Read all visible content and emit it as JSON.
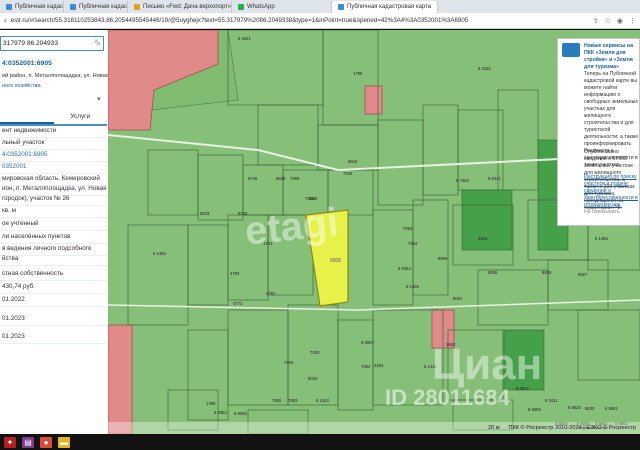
{
  "browser": {
    "tabs": [
      {
        "label": "Публичная кадастровая карта",
        "color": "#3a8fd0"
      },
      {
        "label": "Публичная кадастровая карта",
        "color": "#3a8fd0"
      },
      {
        "label": "Письмо «Fwd: Дача верхопорт»",
        "color": "#e0a21c"
      },
      {
        "label": "WhatsApp",
        "color": "#22b14c"
      },
      {
        "label": "Публичная кадастровая карта",
        "color": "#3a8fd0"
      }
    ],
    "url": "estr.ru/#/search/55.318110253843,86.2054495545446/19/@5uyghejx?text=55.317979%2086.2049338&type=1&inPoint=true&opened=42%3A4%3A0352001%3A6905"
  },
  "panel": {
    "search_value": "317979 86.204933",
    "breadcrumb_line1": "ий район, п. Металлплощадка, ул. Новая",
    "breadcrumb_line2": "ного хозяйства",
    "tab_left": "",
    "tab_right": "Услуги",
    "rows": [
      {
        "text": "ент недвижимости",
        "color": "#333"
      },
      {
        "text": "льный участок",
        "color": "#333"
      },
      {
        "text": "4:0352001:6905",
        "color": "#2a6fba"
      },
      {
        "text": "0352001",
        "color": "#2a6fba"
      },
      {
        "text": "мировская область, Кемеровский",
        "color": "#333"
      },
      {
        "text": "ион, п. Металлплощадка, ул. Новая",
        "color": "#333"
      },
      {
        "text": "городок), участок № 26",
        "color": "#333"
      },
      {
        "text": "кв. м",
        "color": "#333"
      },
      {
        "text": "ое учтенный",
        "color": "#333"
      },
      {
        "text": "ли населённых пунктов",
        "color": "#333"
      },
      {
        "text": "я ведения личного подсобного",
        "color": "#333"
      },
      {
        "text": "йства",
        "color": "#333"
      },
      {
        "text": "стная собственность",
        "color": "#333"
      },
      {
        "text": "430,74 руб.",
        "color": "#333"
      },
      {
        "text": "01.2022",
        "color": "#333"
      },
      {
        "text": "01.2023",
        "color": "#333"
      },
      {
        "text": "01.2023",
        "color": "#333"
      }
    ],
    "header_code": "4:0352001:6905"
  },
  "map": {
    "parcel_labels": [
      "6 2541",
      "1795",
      "6 3432",
      "7025",
      "6 6441",
      "6843",
      "6846",
      "7256",
      "7068",
      "6746",
      "7255",
      "6 7004",
      "8033",
      "8744",
      "1761",
      "6 9454",
      "7064",
      "8081",
      "8016",
      "8836",
      "8859",
      "7054",
      "8835",
      "6 1450",
      "4793",
      "4792",
      "4773",
      "7694",
      "6 9057",
      "7003",
      "8034",
      "1682",
      "6 1412",
      "8827",
      "6 1465",
      "7054",
      "2254",
      "6 1405",
      "1789",
      "7693",
      "7692",
      "6 8255",
      "6 8352",
      "6 1443",
      "6 8822",
      "6 8355",
      "6 8825",
      "6 8824",
      "6 1611",
      "6 8845",
      "8830",
      "6 8851",
      "6 8842",
      "6 8861"
    ],
    "selected_parcel_label": "6905",
    "watermarks": {
      "etagi": "etagi",
      "cian": "Циан",
      "id": "ID 28011684"
    },
    "scale": "20 м",
    "copyright": "ПКК © Росреестр 2010-2024 | ЕЭКО © Росреестр"
  },
  "notification": {
    "title": "Новые сервисы на ПКК «Земля для стройки» и «Земля для туризма»",
    "body1": "Теперь на Публичной кадастровой карте вы можете найти информацию о свободных земельных участках для жилищного строительства и для туристской деятельности, а также проинформировать Росреестр о заинтересованности в таких участках.",
    "body2": "Опубликовано сведений о 57905 земельных участках для жилищного строительства, а также о 299 участках для туризма, находящихся на территории РФ.",
    "instruction": "Инструкция по поиску участков и подаче сведений о заинтересованности в отношении них.",
    "dismiss": "Не показывать"
  },
  "taskbar": {
    "icons": [
      {
        "name": "acrobat-icon",
        "color": "#b41e1e",
        "glyph": "✦"
      },
      {
        "name": "winrar-icon",
        "color": "#7c3a8a",
        "glyph": "▤"
      },
      {
        "name": "chrome-icon",
        "color": "#dd4b39",
        "glyph": "●"
      },
      {
        "name": "folder-icon",
        "color": "#e6b422",
        "glyph": "▬"
      }
    ]
  }
}
